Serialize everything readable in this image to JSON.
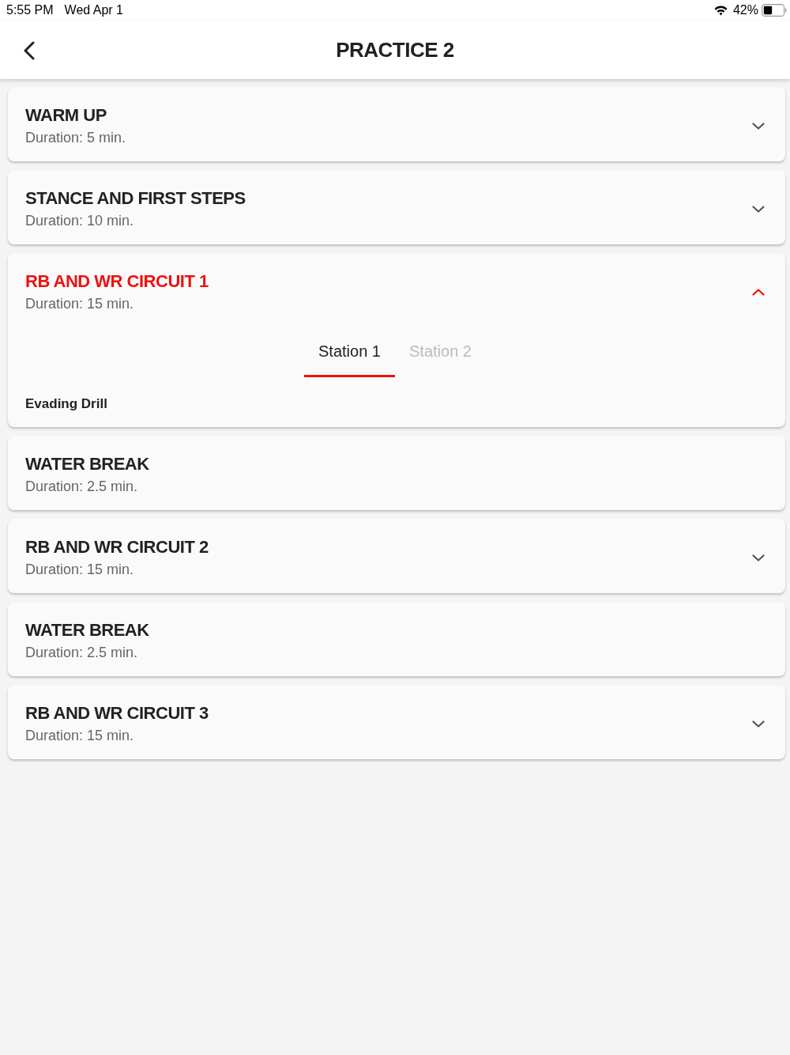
{
  "status_bar": {
    "time": "5:55 PM",
    "date": "Wed Apr 1",
    "battery": "42%"
  },
  "header": {
    "title": "PRACTICE 2"
  },
  "sections": [
    {
      "kind": "expandable",
      "title": "WARM UP",
      "duration": "Duration: 5 min.",
      "expanded": false
    },
    {
      "kind": "expandable",
      "title": "STANCE AND FIRST STEPS",
      "duration": "Duration: 10 min.",
      "expanded": false
    },
    {
      "kind": "expandable",
      "title": "RB AND WR CIRCUIT 1",
      "duration": "Duration: 15 min.",
      "expanded": true,
      "tabs": [
        {
          "label": "Station 1",
          "selected": true
        },
        {
          "label": "Station 2",
          "selected": false
        }
      ],
      "drill": "Evading Drill"
    },
    {
      "kind": "break",
      "title": "WATER BREAK",
      "duration": "Duration: 2.5 min."
    },
    {
      "kind": "expandable",
      "title": "RB AND WR CIRCUIT 2",
      "duration": "Duration: 15 min.",
      "expanded": false
    },
    {
      "kind": "break",
      "title": "WATER BREAK",
      "duration": "Duration: 2.5 min."
    },
    {
      "kind": "expandable",
      "title": "RB AND WR CIRCUIT 3",
      "duration": "Duration: 15 min.",
      "expanded": false
    }
  ]
}
